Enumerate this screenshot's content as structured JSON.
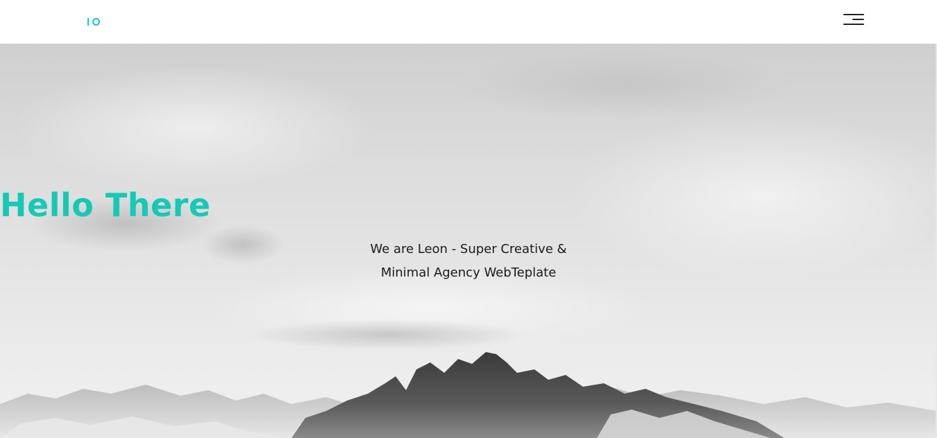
{
  "header": {
    "logo": {
      "icon": "io-logo-icon",
      "accent_color": "#14c9b6"
    },
    "menu_icon": "hamburger-menu-icon"
  },
  "hero": {
    "title": "Hello There",
    "subtitle_line1": "We are Leon - Super Creative &",
    "subtitle_line2": "Minimal Agency WebTeplate",
    "title_color": "#14c9b6",
    "background": "grayscale mountain landscape with cloudy sky"
  }
}
